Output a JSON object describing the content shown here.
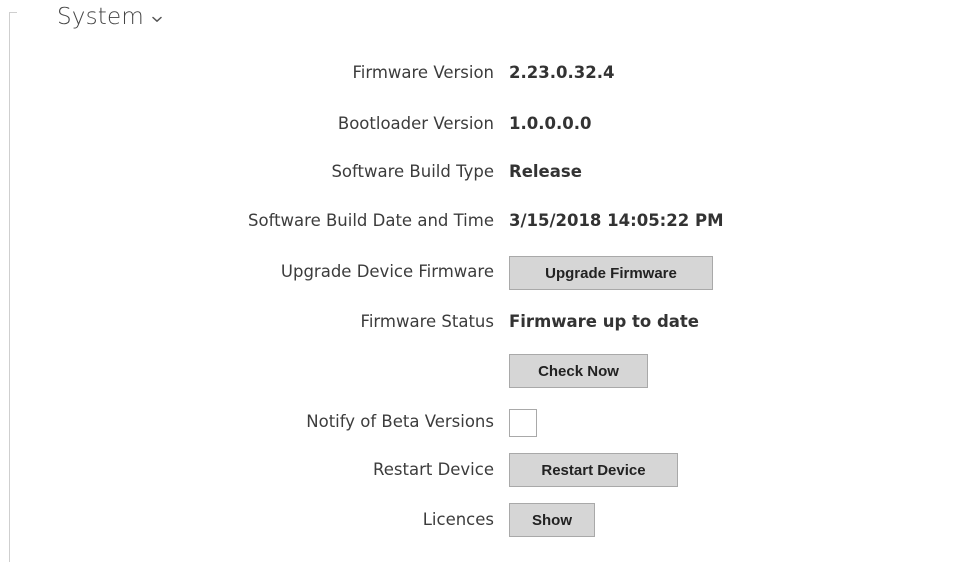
{
  "section": {
    "title": "System",
    "chevron_icon": "chevron-down-icon"
  },
  "rows": {
    "firmware_version": {
      "label": "Firmware Version",
      "value": "2.23.0.32.4"
    },
    "bootloader_version": {
      "label": "Bootloader Version",
      "value": "1.0.0.0.0"
    },
    "build_type": {
      "label": "Software Build Type",
      "value": "Release"
    },
    "build_date": {
      "label": "Software Build Date and Time",
      "value": "3/15/2018 14:05:22 PM"
    },
    "upgrade": {
      "label": "Upgrade Device Firmware",
      "button": "Upgrade Firmware"
    },
    "firmware_status": {
      "label": "Firmware Status",
      "value": "Firmware up to date"
    },
    "check": {
      "button": "Check Now"
    },
    "beta": {
      "label": "Notify of Beta Versions",
      "checked": false
    },
    "restart": {
      "label": "Restart Device",
      "button": "Restart Device"
    },
    "licences": {
      "label": "Licences",
      "button": "Show"
    }
  },
  "colors": {
    "button_bg": "#d6d6d6",
    "button_border": "#a9a9a9",
    "text": "#333333",
    "bracket": "#cfcfcf"
  }
}
